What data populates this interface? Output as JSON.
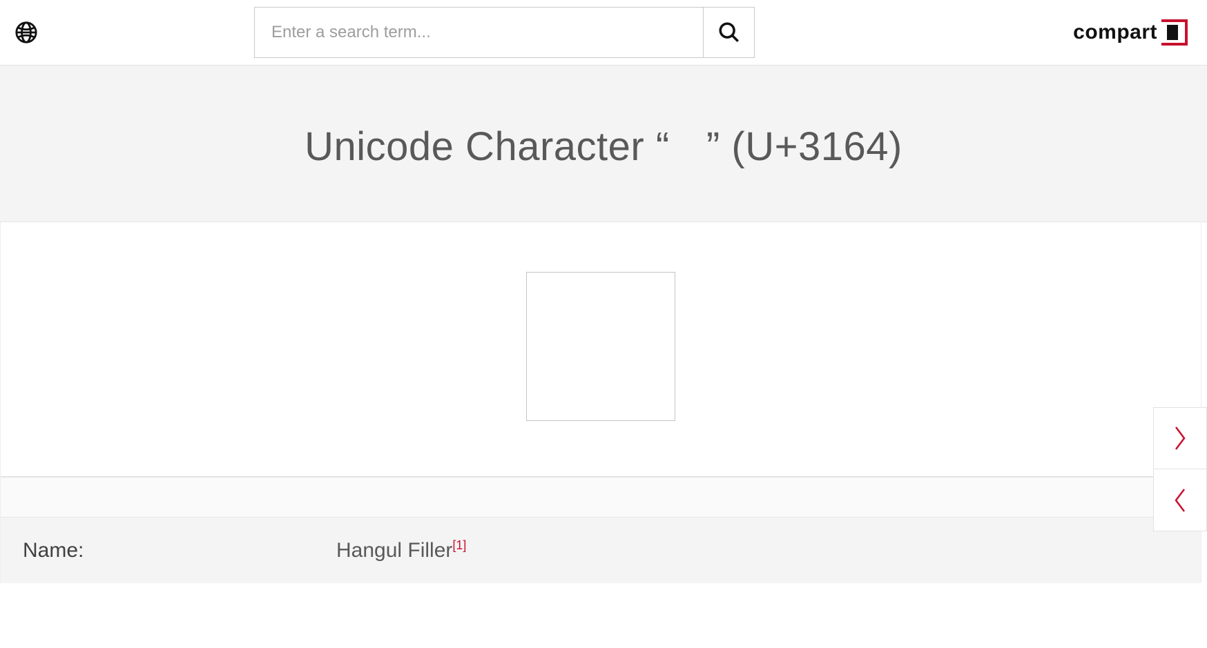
{
  "header": {
    "search_placeholder": "Enter a search term...",
    "logo_text": "compart"
  },
  "page": {
    "title": "Unicode Character “ㅤ” (U+3164)",
    "glyph": "ㅤ"
  },
  "props": {
    "name_label": "Name:",
    "name_value": "Hangul Filler",
    "name_ref": "[1]"
  },
  "colors": {
    "accent": "#c8102e"
  }
}
